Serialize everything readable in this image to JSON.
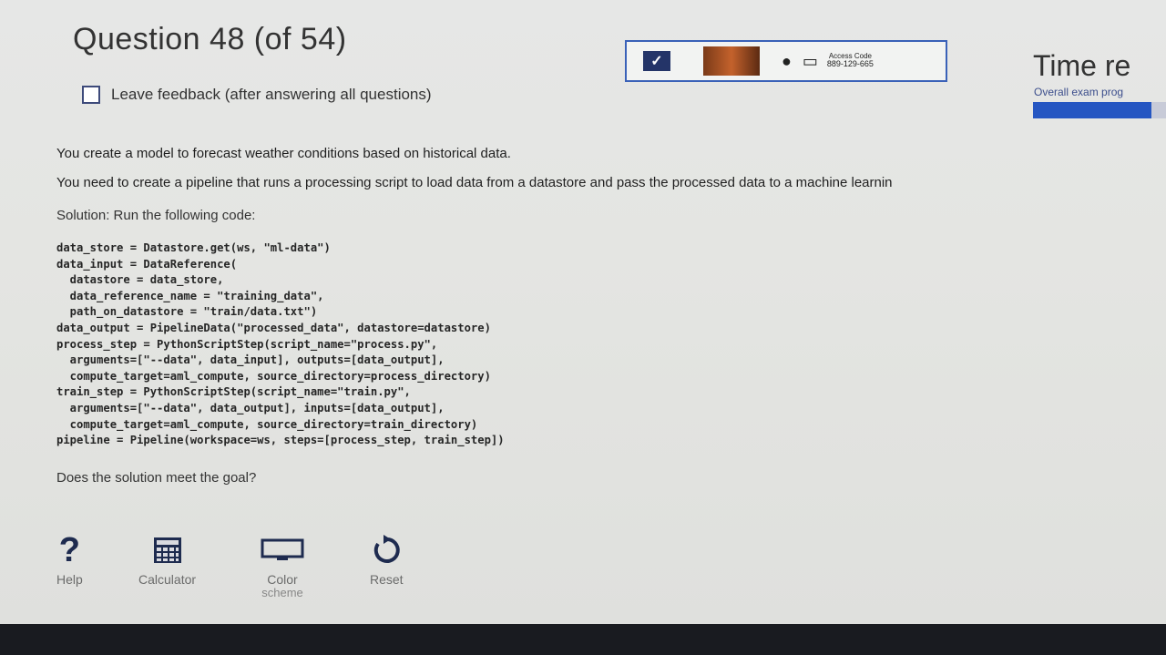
{
  "exam": {
    "question_title": "Question 48 (of 54)",
    "feedback_label": "Leave feedback (after answering all questions)"
  },
  "proctor": {
    "access_code_label": "Access Code",
    "access_code": "889-129-665"
  },
  "timer": {
    "title": "Time re",
    "overall_label": "Overall exam prog",
    "progress_fraction": 0.89
  },
  "question": {
    "line1": "You create a model to forecast weather conditions based on historical data.",
    "line2": "You need to create a pipeline that runs a processing script to load data from a datastore and pass the processed data to a machine learnin",
    "solution": "Solution: Run the following code:",
    "code_lines": [
      "data_store = Datastore.get(ws, \"ml-data\")",
      "data_input = DataReference(",
      "  datastore = data_store,",
      "  data_reference_name = \"training_data\",",
      "  path_on_datastore = \"train/data.txt\")",
      "data_output = PipelineData(\"processed_data\", datastore=datastore)",
      "process_step = PythonScriptStep(script_name=\"process.py\",",
      "  arguments=[\"--data\", data_input], outputs=[data_output],",
      "  compute_target=aml_compute, source_directory=process_directory)",
      "train_step = PythonScriptStep(script_name=\"train.py\",",
      "  arguments=[\"--data\", data_output], inputs=[data_output],",
      "  compute_target=aml_compute, source_directory=train_directory)",
      "pipeline = Pipeline(workspace=ws, steps=[process_step, train_step])"
    ],
    "prompt": "Does the solution meet the goal?"
  },
  "toolbar": {
    "help": "Help",
    "calculator": "Calculator",
    "color_scheme_line1": "Color",
    "color_scheme_line2": "scheme",
    "reset": "Reset"
  },
  "icons": {
    "help": "question-mark-icon",
    "calculator": "calculator-icon",
    "color_scheme": "monitor-icon",
    "reset": "reset-arrow-icon"
  },
  "colors": {
    "accent_blue": "#2556c2",
    "help_navy": "#1e2b4f"
  }
}
